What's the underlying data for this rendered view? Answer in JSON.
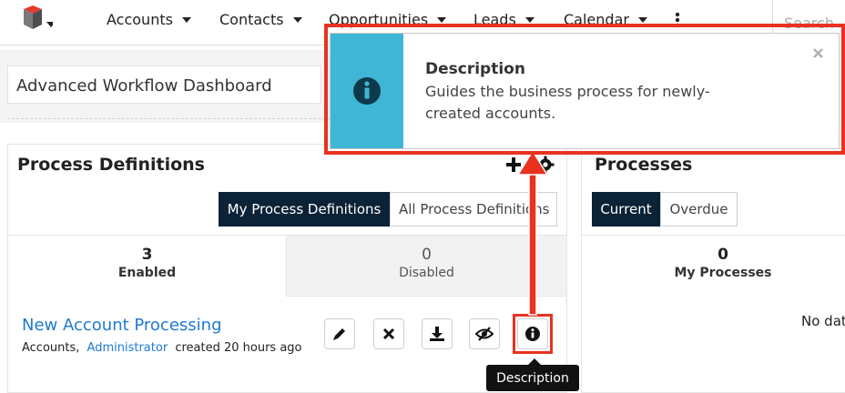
{
  "nav": {
    "items": [
      {
        "label": "Accounts"
      },
      {
        "label": "Contacts"
      },
      {
        "label": "Opportunities"
      },
      {
        "label": "Leads"
      },
      {
        "label": "Calendar"
      }
    ],
    "more_icon": "kebab-icon",
    "search_placeholder": "Search",
    "logo_icon": "cube-logo-icon"
  },
  "dashboard": {
    "title": "Advanced Workflow Dashboard"
  },
  "process_definitions": {
    "title": "Process Definitions",
    "add_icon": "plus-icon",
    "settings_icon": "gear-icon",
    "filters": [
      "My Process Definitions",
      "All Process Definitions"
    ],
    "stats": [
      {
        "count": "3",
        "label": "Enabled"
      },
      {
        "count": "0",
        "label": "Disabled"
      }
    ],
    "record": {
      "name": "New Account Processing",
      "module": "Accounts,",
      "user": "Administrator",
      "created": "created 20 hours ago"
    },
    "actions": [
      "pencil-icon",
      "close-icon",
      "download-icon",
      "eye-slash-icon",
      "info-icon"
    ]
  },
  "processes": {
    "title": "Processes",
    "filters": [
      "Current",
      "Overdue"
    ],
    "stats": [
      {
        "count": "0",
        "label": "My Processes"
      }
    ],
    "no_data": "No dat"
  },
  "popover": {
    "heading": "Description",
    "body": "Guides the business process for newly-created accounts.",
    "line1": "Guides the business process for newly-",
    "line2": "created accounts."
  },
  "tooltip": {
    "text": "Description"
  },
  "colors": {
    "accent": "#e8321f",
    "nav_dark": "#0b2237",
    "info_blue": "#40b6d6",
    "link": "#1f7ad1"
  }
}
